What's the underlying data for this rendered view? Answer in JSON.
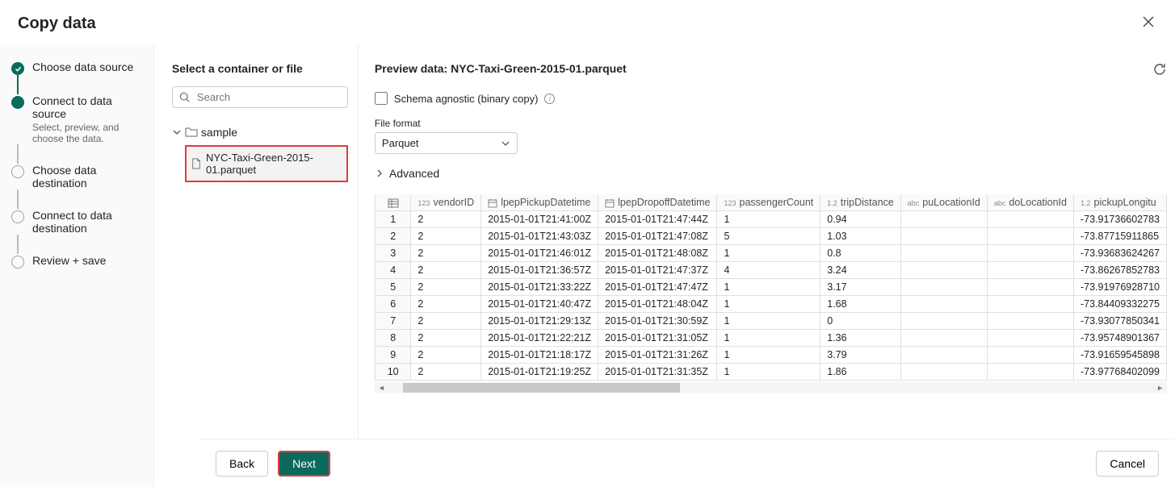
{
  "header": {
    "title": "Copy data"
  },
  "sidebar": {
    "steps": [
      {
        "label": "Choose data source",
        "sub": ""
      },
      {
        "label": "Connect to data source",
        "sub": "Select, preview, and choose the data."
      },
      {
        "label": "Choose data destination",
        "sub": ""
      },
      {
        "label": "Connect to data destination",
        "sub": ""
      },
      {
        "label": "Review + save",
        "sub": ""
      }
    ]
  },
  "filePanel": {
    "title": "Select a container or file",
    "searchPlaceholder": "Search",
    "folder": "sample",
    "file": "NYC-Taxi-Green-2015-01.parquet"
  },
  "preview": {
    "titlePrefix": "Preview data: ",
    "fileName": "NYC-Taxi-Green-2015-01.parquet",
    "schemaAgnostic": "Schema agnostic (binary copy)",
    "fileFormatLabel": "File format",
    "fileFormat": "Parquet",
    "advanced": "Advanced",
    "columns": [
      {
        "type": "123",
        "name": "vendorID"
      },
      {
        "type": "cal",
        "name": "lpepPickupDatetime"
      },
      {
        "type": "cal",
        "name": "lpepDropoffDatetime"
      },
      {
        "type": "123",
        "name": "passengerCount"
      },
      {
        "type": "1.2",
        "name": "tripDistance"
      },
      {
        "type": "abc",
        "name": "puLocationId"
      },
      {
        "type": "abc",
        "name": "doLocationId"
      },
      {
        "type": "1.2",
        "name": "pickupLongitu"
      }
    ],
    "rows": [
      [
        "1",
        "2",
        "2015-01-01T21:41:00Z",
        "2015-01-01T21:47:44Z",
        "1",
        "0.94",
        "",
        "",
        "-73.91736602783"
      ],
      [
        "2",
        "2",
        "2015-01-01T21:43:03Z",
        "2015-01-01T21:47:08Z",
        "5",
        "1.03",
        "",
        "",
        "-73.87715911865"
      ],
      [
        "3",
        "2",
        "2015-01-01T21:46:01Z",
        "2015-01-01T21:48:08Z",
        "1",
        "0.8",
        "",
        "",
        "-73.93683624267"
      ],
      [
        "4",
        "2",
        "2015-01-01T21:36:57Z",
        "2015-01-01T21:47:37Z",
        "4",
        "3.24",
        "",
        "",
        "-73.86267852783"
      ],
      [
        "5",
        "2",
        "2015-01-01T21:33:22Z",
        "2015-01-01T21:47:47Z",
        "1",
        "3.17",
        "",
        "",
        "-73.91976928710"
      ],
      [
        "6",
        "2",
        "2015-01-01T21:40:47Z",
        "2015-01-01T21:48:04Z",
        "1",
        "1.68",
        "",
        "",
        "-73.84409332275"
      ],
      [
        "7",
        "2",
        "2015-01-01T21:29:13Z",
        "2015-01-01T21:30:59Z",
        "1",
        "0",
        "",
        "",
        "-73.93077850341"
      ],
      [
        "8",
        "2",
        "2015-01-01T21:22:21Z",
        "2015-01-01T21:31:05Z",
        "1",
        "1.36",
        "",
        "",
        "-73.95748901367"
      ],
      [
        "9",
        "2",
        "2015-01-01T21:18:17Z",
        "2015-01-01T21:31:26Z",
        "1",
        "3.79",
        "",
        "",
        "-73.91659545898"
      ],
      [
        "10",
        "2",
        "2015-01-01T21:19:25Z",
        "2015-01-01T21:31:35Z",
        "1",
        "1.86",
        "",
        "",
        "-73.97768402099"
      ]
    ]
  },
  "footer": {
    "back": "Back",
    "next": "Next",
    "cancel": "Cancel"
  }
}
